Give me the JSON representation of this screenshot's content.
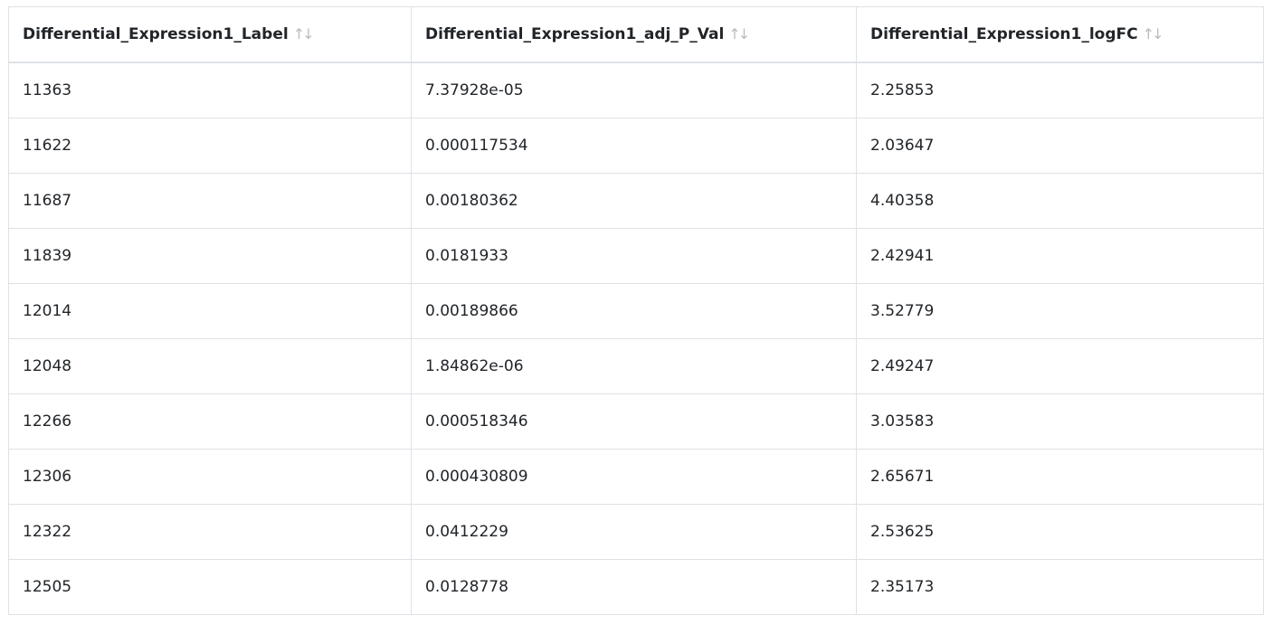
{
  "table": {
    "columns": [
      {
        "label": "Differential_Expression1_Label",
        "sort_icon": "sort-icon"
      },
      {
        "label": "Differential_Expression1_adj_P_Val",
        "sort_icon": "sort-icon"
      },
      {
        "label": "Differential_Expression1_logFC",
        "sort_icon": "sort-icon"
      }
    ],
    "sort_glyph": "↑↓",
    "rows": [
      [
        "11363",
        "7.37928e-05",
        "2.25853"
      ],
      [
        "11622",
        "0.000117534",
        "2.03647"
      ],
      [
        "11687",
        "0.00180362",
        "4.40358"
      ],
      [
        "11839",
        "0.0181933",
        "2.42941"
      ],
      [
        "12014",
        "0.00189866",
        "3.52779"
      ],
      [
        "12048",
        "1.84862e-06",
        "2.49247"
      ],
      [
        "12266",
        "0.000518346",
        "3.03583"
      ],
      [
        "12306",
        "0.000430809",
        "2.65671"
      ],
      [
        "12322",
        "0.0412229",
        "2.53625"
      ],
      [
        "12505",
        "0.0128778",
        "2.35173"
      ]
    ]
  },
  "colors": {
    "border": "#dee2e6",
    "text": "#212529",
    "sort_icon": "#b8bcc0"
  }
}
